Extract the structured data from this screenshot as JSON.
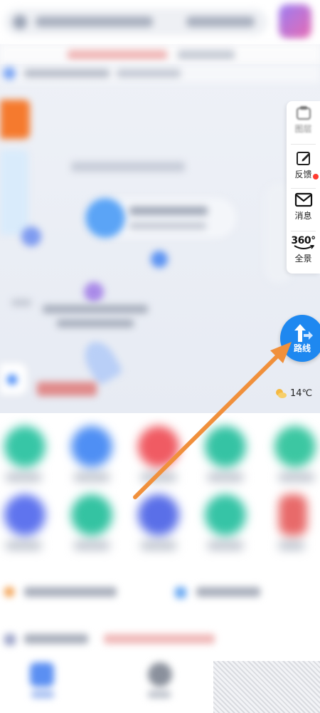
{
  "toolbar": {
    "items": [
      {
        "label": "图层"
      },
      {
        "label": "反馈"
      },
      {
        "label": "消息"
      },
      {
        "label": "全景",
        "badge": "360°"
      }
    ]
  },
  "route_button": {
    "label": "路线"
  },
  "weather": {
    "temperature": "14℃"
  },
  "colors": {
    "accent": "#1e88f0",
    "annotation_arrow": "#f0903c",
    "notification_dot": "#ff3b30"
  }
}
